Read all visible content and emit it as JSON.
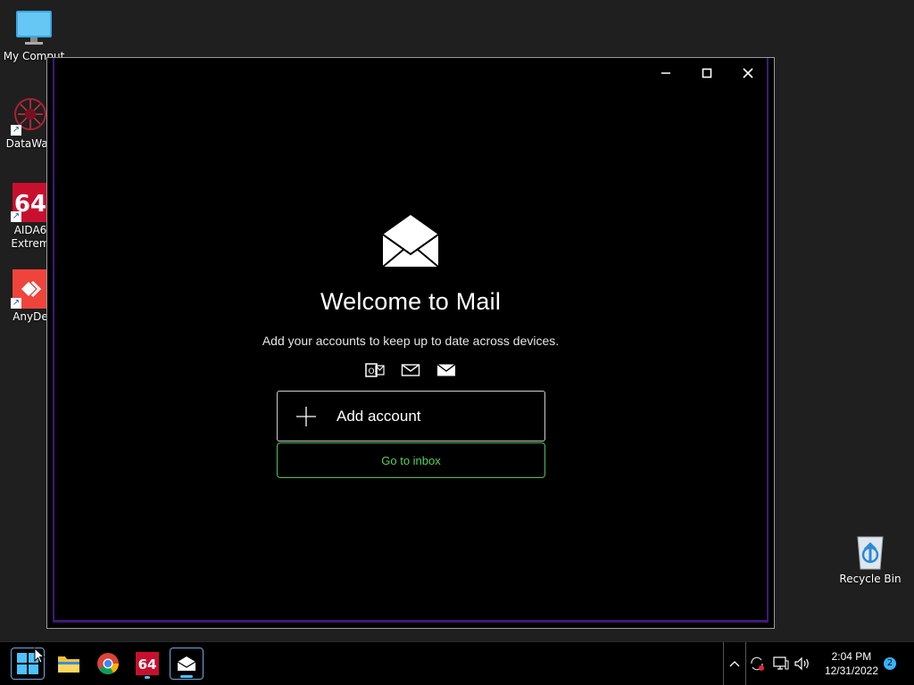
{
  "desktop": {
    "icons": [
      {
        "label": "My Comput"
      },
      {
        "label": "DataWag"
      },
      {
        "label": "AIDA6\nExtrem"
      },
      {
        "label": "AnyDe"
      },
      {
        "label": "Recycle Bin"
      }
    ]
  },
  "mail": {
    "title": "Welcome to Mail",
    "subtitle": "Add your accounts to keep up to date across devices.",
    "provider_icons": [
      "outlook-exchange-icon",
      "mail-outline-icon",
      "mail-filled-icon"
    ],
    "add_account_label": "Add account",
    "go_to_inbox_label": "Go to inbox",
    "accent_color": "#55d05f",
    "frame_color": "#3d1a78"
  },
  "taskbar": {
    "apps": [
      "start-icon",
      "file-explorer-icon",
      "chrome-icon",
      "aida64-icon",
      "mail-icon"
    ],
    "clock": {
      "time": "2:04 PM",
      "date": "12/31/2022"
    },
    "notification_count": "2"
  }
}
